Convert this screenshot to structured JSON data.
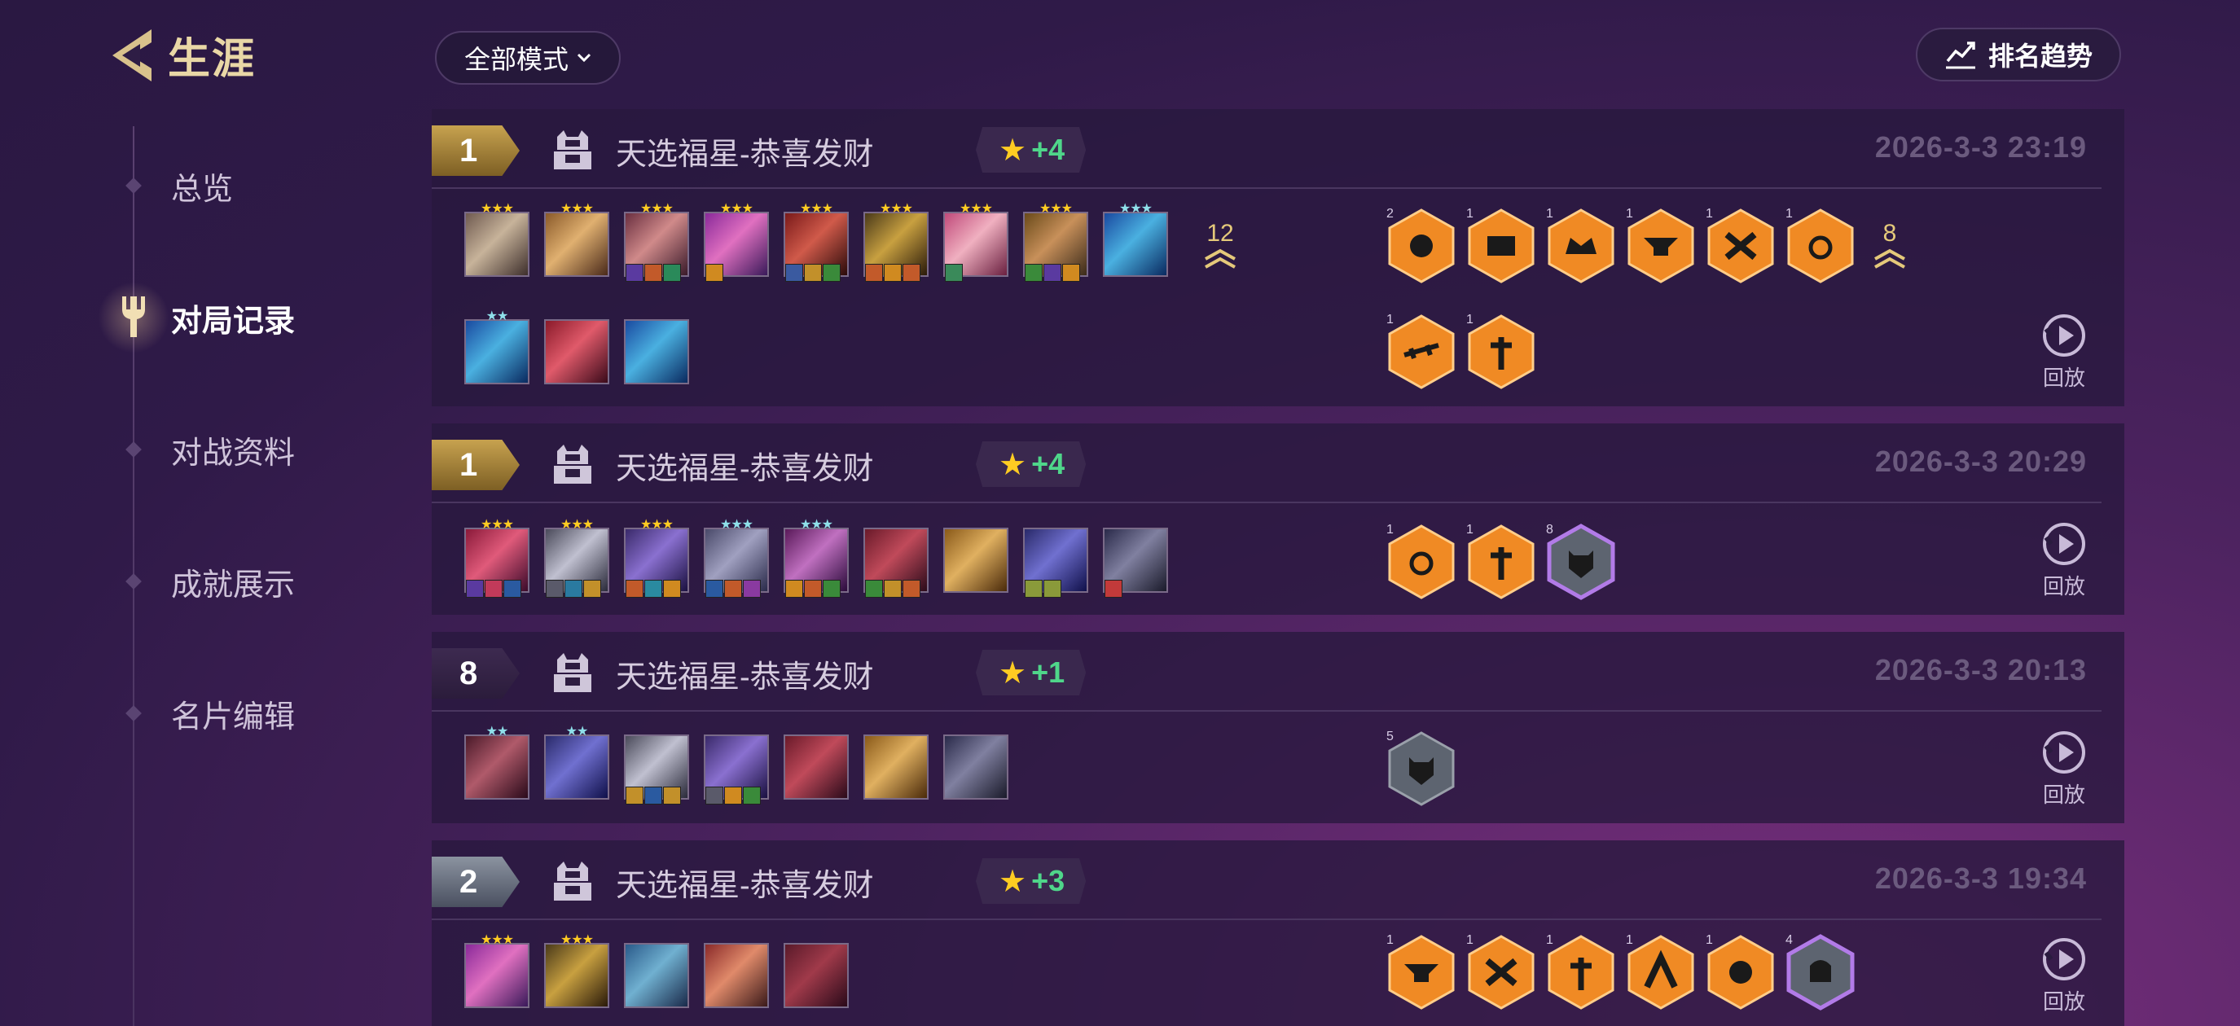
{
  "header": {
    "title": "生涯",
    "mode_filter": "全部模式",
    "trend_button": "排名趋势"
  },
  "sidebar": {
    "items": [
      {
        "label": "总览"
      },
      {
        "label": "对局记录",
        "active": true
      },
      {
        "label": "对战资料"
      },
      {
        "label": "成就展示"
      },
      {
        "label": "名片编辑"
      }
    ]
  },
  "records": [
    {
      "rank": "1",
      "mode": "天选福星-恭喜发财",
      "points": "+4",
      "date": "2026-3-3   23:19",
      "level": "12",
      "trait_level": "8",
      "replay": "回放",
      "trait_counts": [
        "2",
        "1",
        "1",
        "1",
        "1",
        "1",
        "1",
        "1"
      ]
    },
    {
      "rank": "1",
      "mode": "天选福星-恭喜发财",
      "points": "+4",
      "date": "2026-3-3   20:29",
      "replay": "回放",
      "trait_counts": [
        "1",
        "1",
        "8"
      ]
    },
    {
      "rank": "8",
      "mode": "天选福星-恭喜发财",
      "points": "+1",
      "date": "2026-3-3   20:13",
      "replay": "回放",
      "trait_counts": [
        "5"
      ]
    },
    {
      "rank": "2",
      "mode": "天选福星-恭喜发财",
      "points": "+3",
      "date": "2026-3-3   19:34",
      "replay": "回放",
      "trait_counts": [
        "1",
        "1",
        "1",
        "1",
        "1",
        "4"
      ]
    }
  ],
  "colors": {
    "gold": "#c7a24f",
    "points_green": "#4fd68a",
    "trait_orange": "#f08a24",
    "trait_gray": "#5d6470",
    "trait_prism": "#b27be8"
  },
  "icons": [
    "back-chevron-icon",
    "trophy-fork-icon",
    "chevron-down-icon",
    "trend-chart-icon",
    "mode-robot-icon",
    "star-icon",
    "replay-icon",
    "trait-hex-icon",
    "level-up-icon"
  ]
}
